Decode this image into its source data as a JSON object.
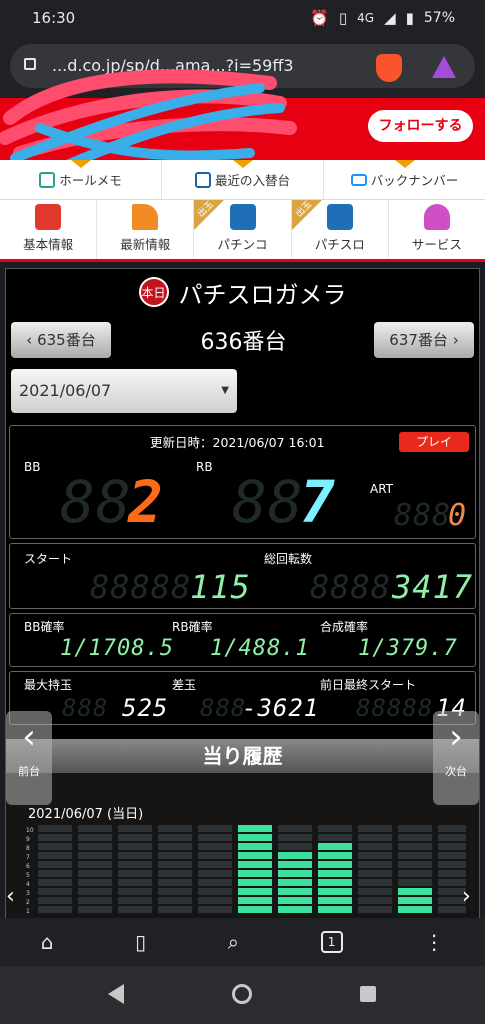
{
  "status": {
    "time": "16:30",
    "network": "4G",
    "battery": "57%"
  },
  "browser": {
    "url": "...d.co.jp/sp/d...ama...?i=59ff3",
    "tab_count": "1"
  },
  "header": {
    "follow_label": "フォローする"
  },
  "subnav": [
    {
      "label": "ホールメモ",
      "icon": "memo-icon"
    },
    {
      "label": "最近の入替台",
      "icon": "new-machine-icon"
    },
    {
      "label": "バックナンバー",
      "icon": "mail-icon"
    }
  ],
  "mainnav": [
    {
      "label": "基本情報",
      "icon": "shop-icon"
    },
    {
      "label": "最新情報",
      "icon": "party-popper-icon"
    },
    {
      "label": "パチンコ",
      "icon": "pachinko-icon",
      "flag": "出玉"
    },
    {
      "label": "パチスロ",
      "icon": "slot-icon",
      "flag": "出玉"
    },
    {
      "label": "サービス",
      "icon": "person-icon"
    }
  ],
  "panel": {
    "title": "パチスロガメラ",
    "logo_text": "本日",
    "prev_unit": "635番台",
    "current_unit": "636番台",
    "next_unit": "637番台",
    "date": "2021/06/07",
    "updated": "更新日時：2021/06/07 16:01",
    "play_label": "プレイ",
    "bb_label": "BB",
    "rb_label": "RB",
    "art_label": "ART",
    "bb": "2",
    "rb": "7",
    "art": "0",
    "start_label": "スタート",
    "start": "115",
    "total_label": "総回転数",
    "total": "3417",
    "bb_rate_label": "BB確率",
    "bb_rate": "1/1708.5",
    "rb_rate_label": "RB確率",
    "rb_rate": "1/488.1",
    "combined_label": "合成確率",
    "combined_rate": "1/379.7",
    "max_label": "最大持玉",
    "max_balls": "525",
    "diff_label": "差玉",
    "diff": "-3621",
    "prev_start_label": "前日最終スタート",
    "prev_start": "14",
    "history_title": "当り履歴",
    "prev_day": "前台",
    "next_day": "次台",
    "history_date": "2021/06/07 (当日)"
  },
  "colors": {
    "red": "#e60012",
    "bb": "#ff6a1a",
    "rb": "#7ff0ff",
    "green": "#8ff0a8",
    "art": "#f08a4b"
  },
  "history_levels": [
    0,
    0,
    0,
    0,
    0,
    10,
    7,
    8,
    0,
    3,
    0,
    0
  ]
}
